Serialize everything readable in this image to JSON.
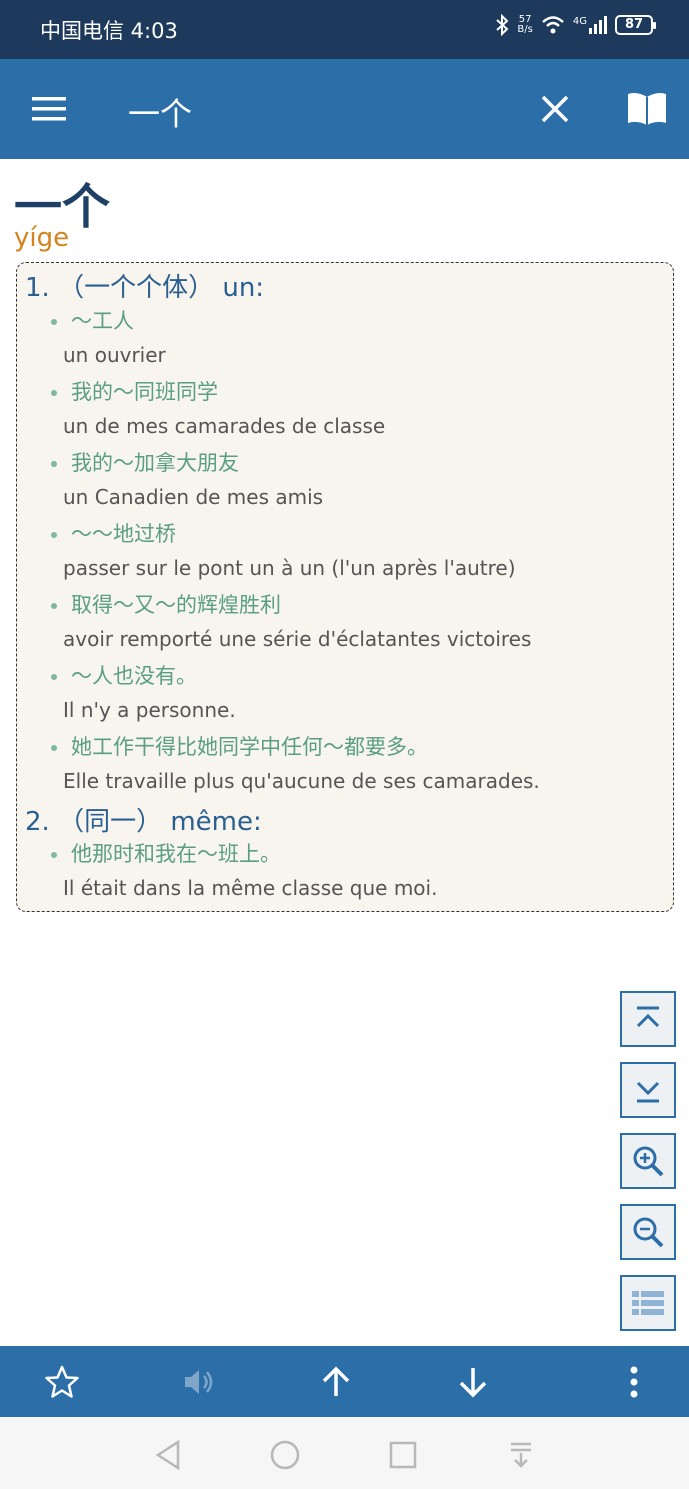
{
  "status_bar": {
    "carrier_time": "中国电信 4:03",
    "net_speed_value": "57",
    "net_speed_unit": "B/s",
    "network": "4G",
    "battery": "87"
  },
  "app_bar": {
    "title": "一个",
    "icons": [
      "menu-icon",
      "close-icon",
      "book-icon"
    ]
  },
  "entry": {
    "headword": "一个",
    "pinyin": "yíge",
    "senses": [
      {
        "label": "1. （一个个体） un:",
        "examples": [
          {
            "zh": "～工人",
            "fr": "un ouvrier"
          },
          {
            "zh": "我的～同班同学",
            "fr": "un de mes camarades de classe"
          },
          {
            "zh": "我的～加拿大朋友",
            "fr": "un Canadien de mes amis"
          },
          {
            "zh": "～～地过桥",
            "fr": "passer sur le pont un à un (l'un après l'autre)"
          },
          {
            "zh": "取得～又～的辉煌胜利",
            "fr": "avoir remporté une série d'éclatantes victoires"
          },
          {
            "zh": "～人也没有。",
            "fr": "Il n'y a personne."
          },
          {
            "zh": "她工作干得比她同学中任何～都要多。",
            "fr": "Elle travaille plus qu'aucune de ses camarades."
          }
        ]
      },
      {
        "label": "2. （同一） même:",
        "examples": [
          {
            "zh": "他那时和我在～班上。",
            "fr": "Il était dans la même classe que moi."
          }
        ]
      }
    ]
  },
  "side_buttons": [
    "scroll-top-icon",
    "scroll-bottom-icon",
    "zoom-in-icon",
    "zoom-out-icon",
    "list-icon"
  ],
  "bottom_bar": [
    "star-icon",
    "speaker-icon",
    "arrow-up-icon",
    "arrow-down-icon",
    "more-icon"
  ],
  "nav_bar": [
    "back-icon",
    "home-icon",
    "recents-icon",
    "notification-icon"
  ],
  "colors": {
    "status_bar": "#1d3a5c",
    "app_bar": "#2c6fa8",
    "headword": "#1e3f66",
    "pinyin": "#d4841e",
    "sense": "#2a5f92",
    "example": "#5a9f82",
    "translation": "#555555",
    "box_bg": "#f8f4ee"
  }
}
